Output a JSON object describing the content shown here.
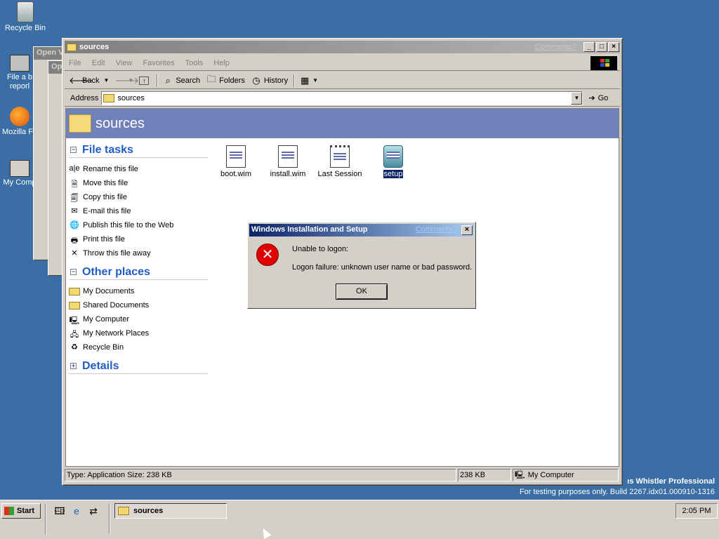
{
  "desktop": {
    "icons": [
      {
        "label": "Recycle Bin"
      },
      {
        "label": "File a b reporl"
      },
      {
        "label": "Mozilla Fir"
      },
      {
        "label": "My Comp"
      }
    ],
    "bg_windows": [
      {
        "title": "Open V"
      },
      {
        "title": "Op"
      }
    ],
    "watermark_line1": "ıs Whistler Professional",
    "watermark_line2": "For testing purposes only. Build 2267.idx01.000910-1316"
  },
  "window": {
    "title": "sources",
    "comments_link": "Comments?",
    "controls": {
      "minimize": "_",
      "maximize": "□",
      "close": "×"
    },
    "menu": [
      "File",
      "Edit",
      "View",
      "Favorites",
      "Tools",
      "Help"
    ],
    "toolbar": {
      "back": "Back",
      "search": "Search",
      "folders": "Folders",
      "history": "History"
    },
    "address": {
      "label": "Address",
      "value": "sources",
      "go": "Go"
    },
    "header_title": "sources",
    "tasks": {
      "file_tasks": {
        "title": "File tasks",
        "items": [
          "Rename this file",
          "Move this file",
          "Copy this file",
          "E-mail this file",
          "Publish this file to the Web",
          "Print this file",
          "Throw this file away"
        ]
      },
      "other_places": {
        "title": "Other places",
        "items": [
          "My Documents",
          "Shared Documents",
          "My Computer",
          "My Network Places",
          "Recycle Bin"
        ]
      },
      "details": {
        "title": "Details"
      }
    },
    "files": [
      {
        "name": "boot.wim"
      },
      {
        "name": "install.wim"
      },
      {
        "name": "Last Session"
      },
      {
        "name": "setup"
      }
    ],
    "status": {
      "info": "Type: Application Size: 238 KB",
      "size": "238 KB",
      "zone": "My Computer"
    }
  },
  "dialog": {
    "title": "Windows Installation and Setup",
    "comments_link": "Comments?",
    "line1": "Unable to logon:",
    "line2": "Logon failure: unknown user name or bad password.",
    "ok": "OK",
    "icon": "error-icon"
  },
  "taskbar": {
    "start": "Start",
    "active_task": "sources",
    "clock": "2:05 PM"
  }
}
